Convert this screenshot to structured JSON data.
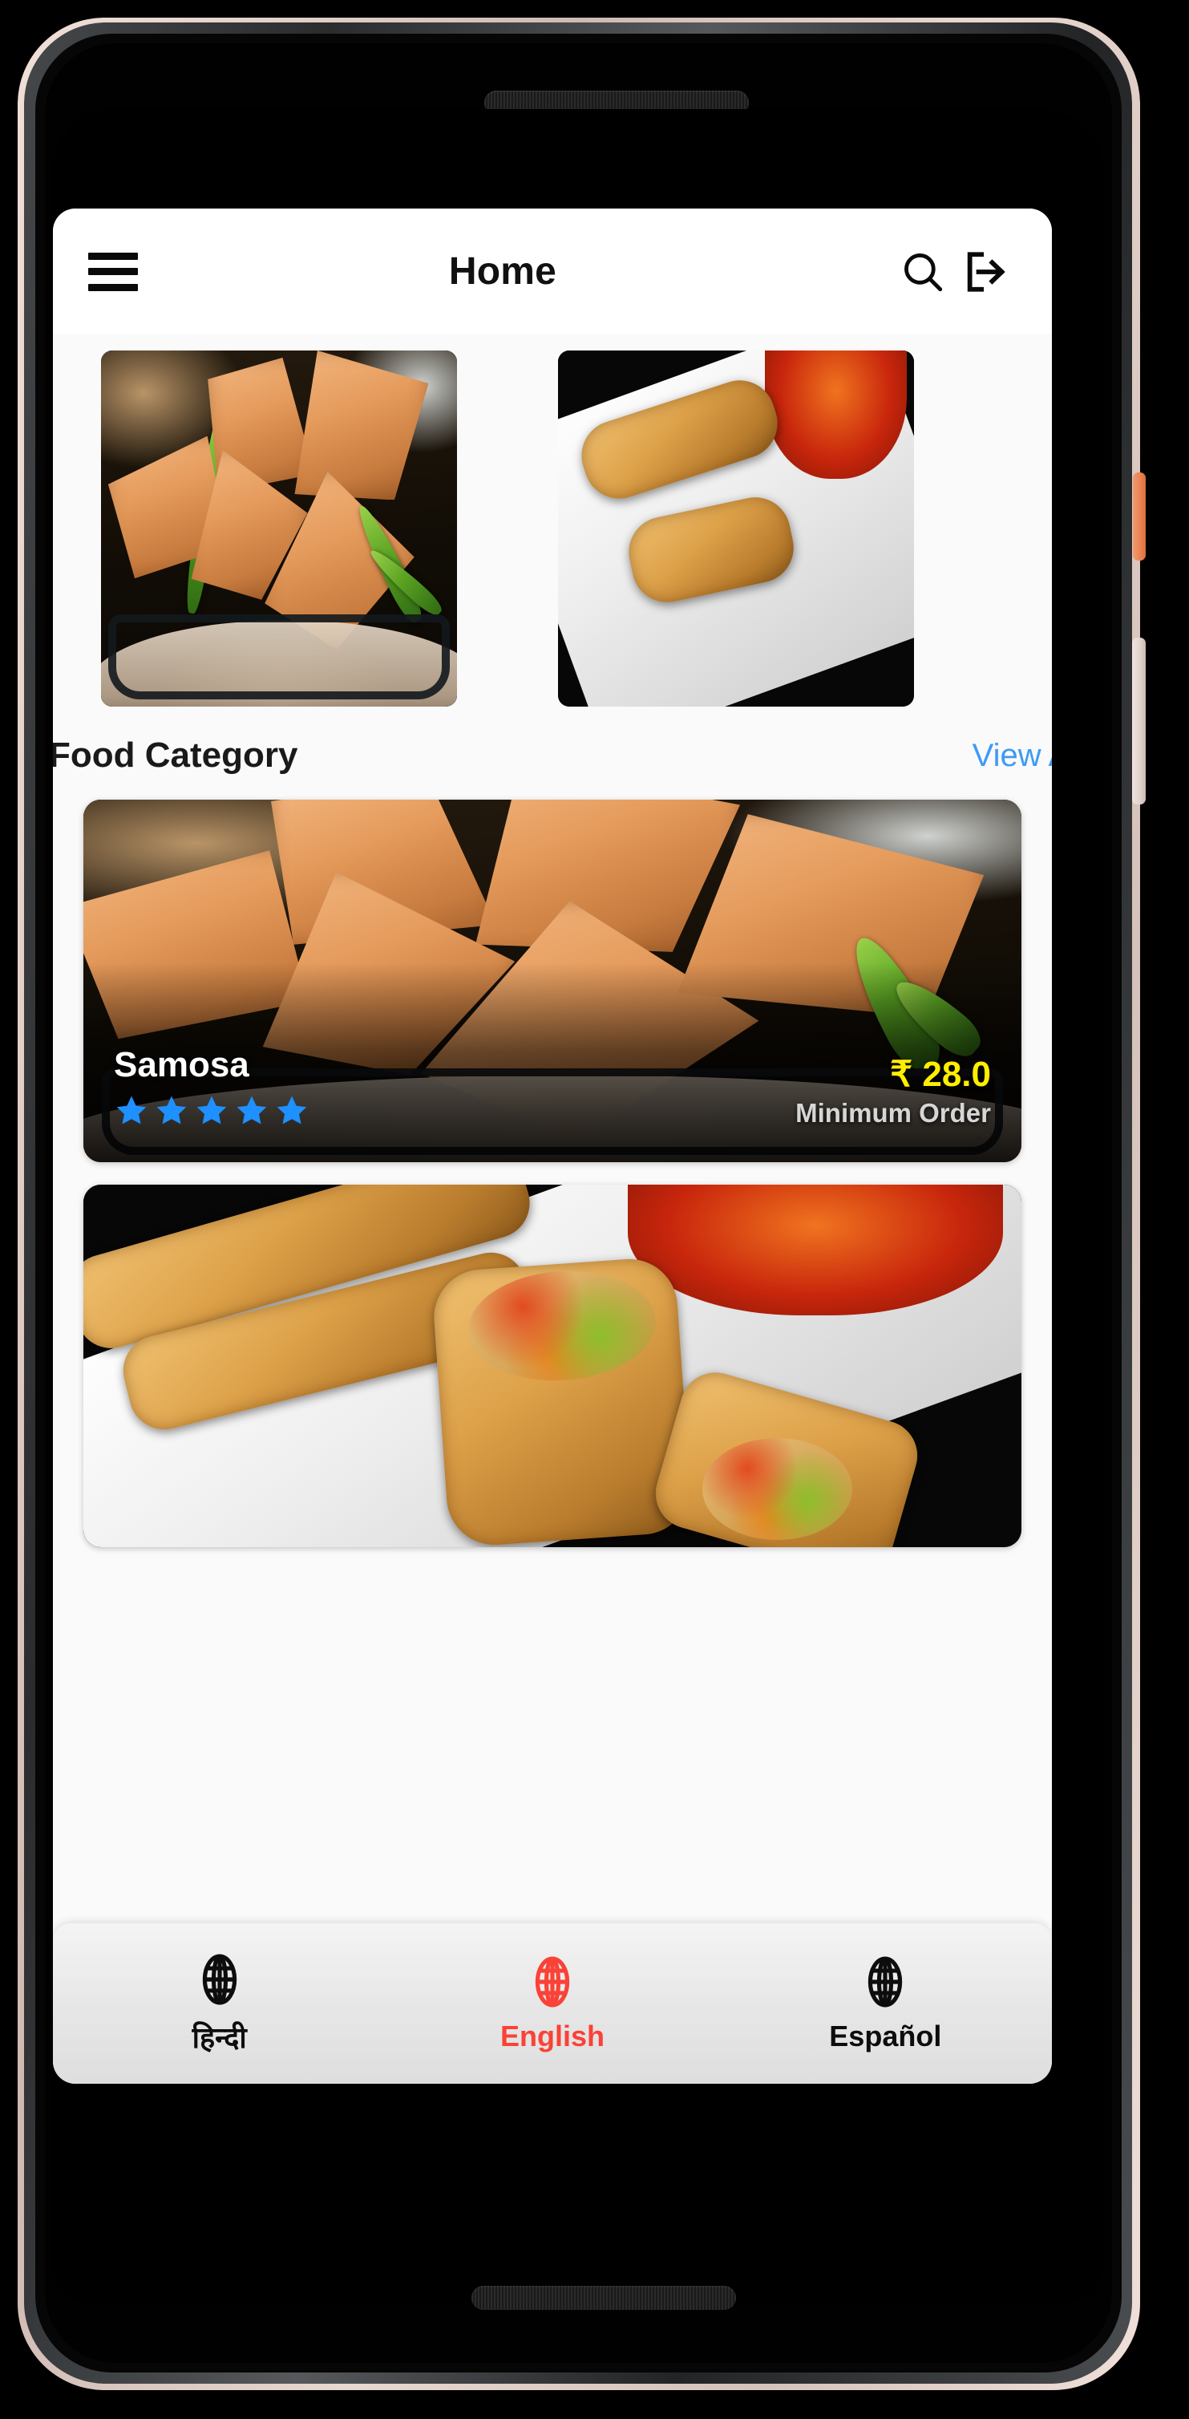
{
  "app": {
    "title": "Home",
    "icons": {
      "menu": "hamburger-menu-icon",
      "search": "search-icon",
      "logout": "logout-icon"
    }
  },
  "banner": {
    "slides": [
      {
        "alt": "samosa-banner"
      },
      {
        "alt": "next-banner"
      }
    ]
  },
  "section": {
    "title": "Food Category",
    "view_all": "View All"
  },
  "food_items": [
    {
      "name": "Samosa",
      "price": "₹ 28.0",
      "subtitle": "Minimum Order",
      "rating": 5,
      "image": "samosa-photo"
    },
    {
      "name": "",
      "price": "",
      "subtitle": "",
      "rating": 0,
      "image": "spring-roll-photo"
    }
  ],
  "languages": [
    {
      "label": "हिन्दी",
      "selected": false,
      "icon": "globe-icon"
    },
    {
      "label": "English",
      "selected": true,
      "icon": "globe-icon"
    },
    {
      "label": "Español",
      "selected": false,
      "icon": "globe-icon"
    }
  ],
  "colors": {
    "accent_blue": "#3d9bf4",
    "star_blue": "#1e90ff",
    "price_yellow": "#ffee00",
    "selected_red": "#fa4236",
    "app_background": "#fafafa",
    "bar_background": "#ffffff"
  },
  "device": {
    "power_button_color": "#ec8152",
    "volume_button_color": "#e2d2cb"
  }
}
